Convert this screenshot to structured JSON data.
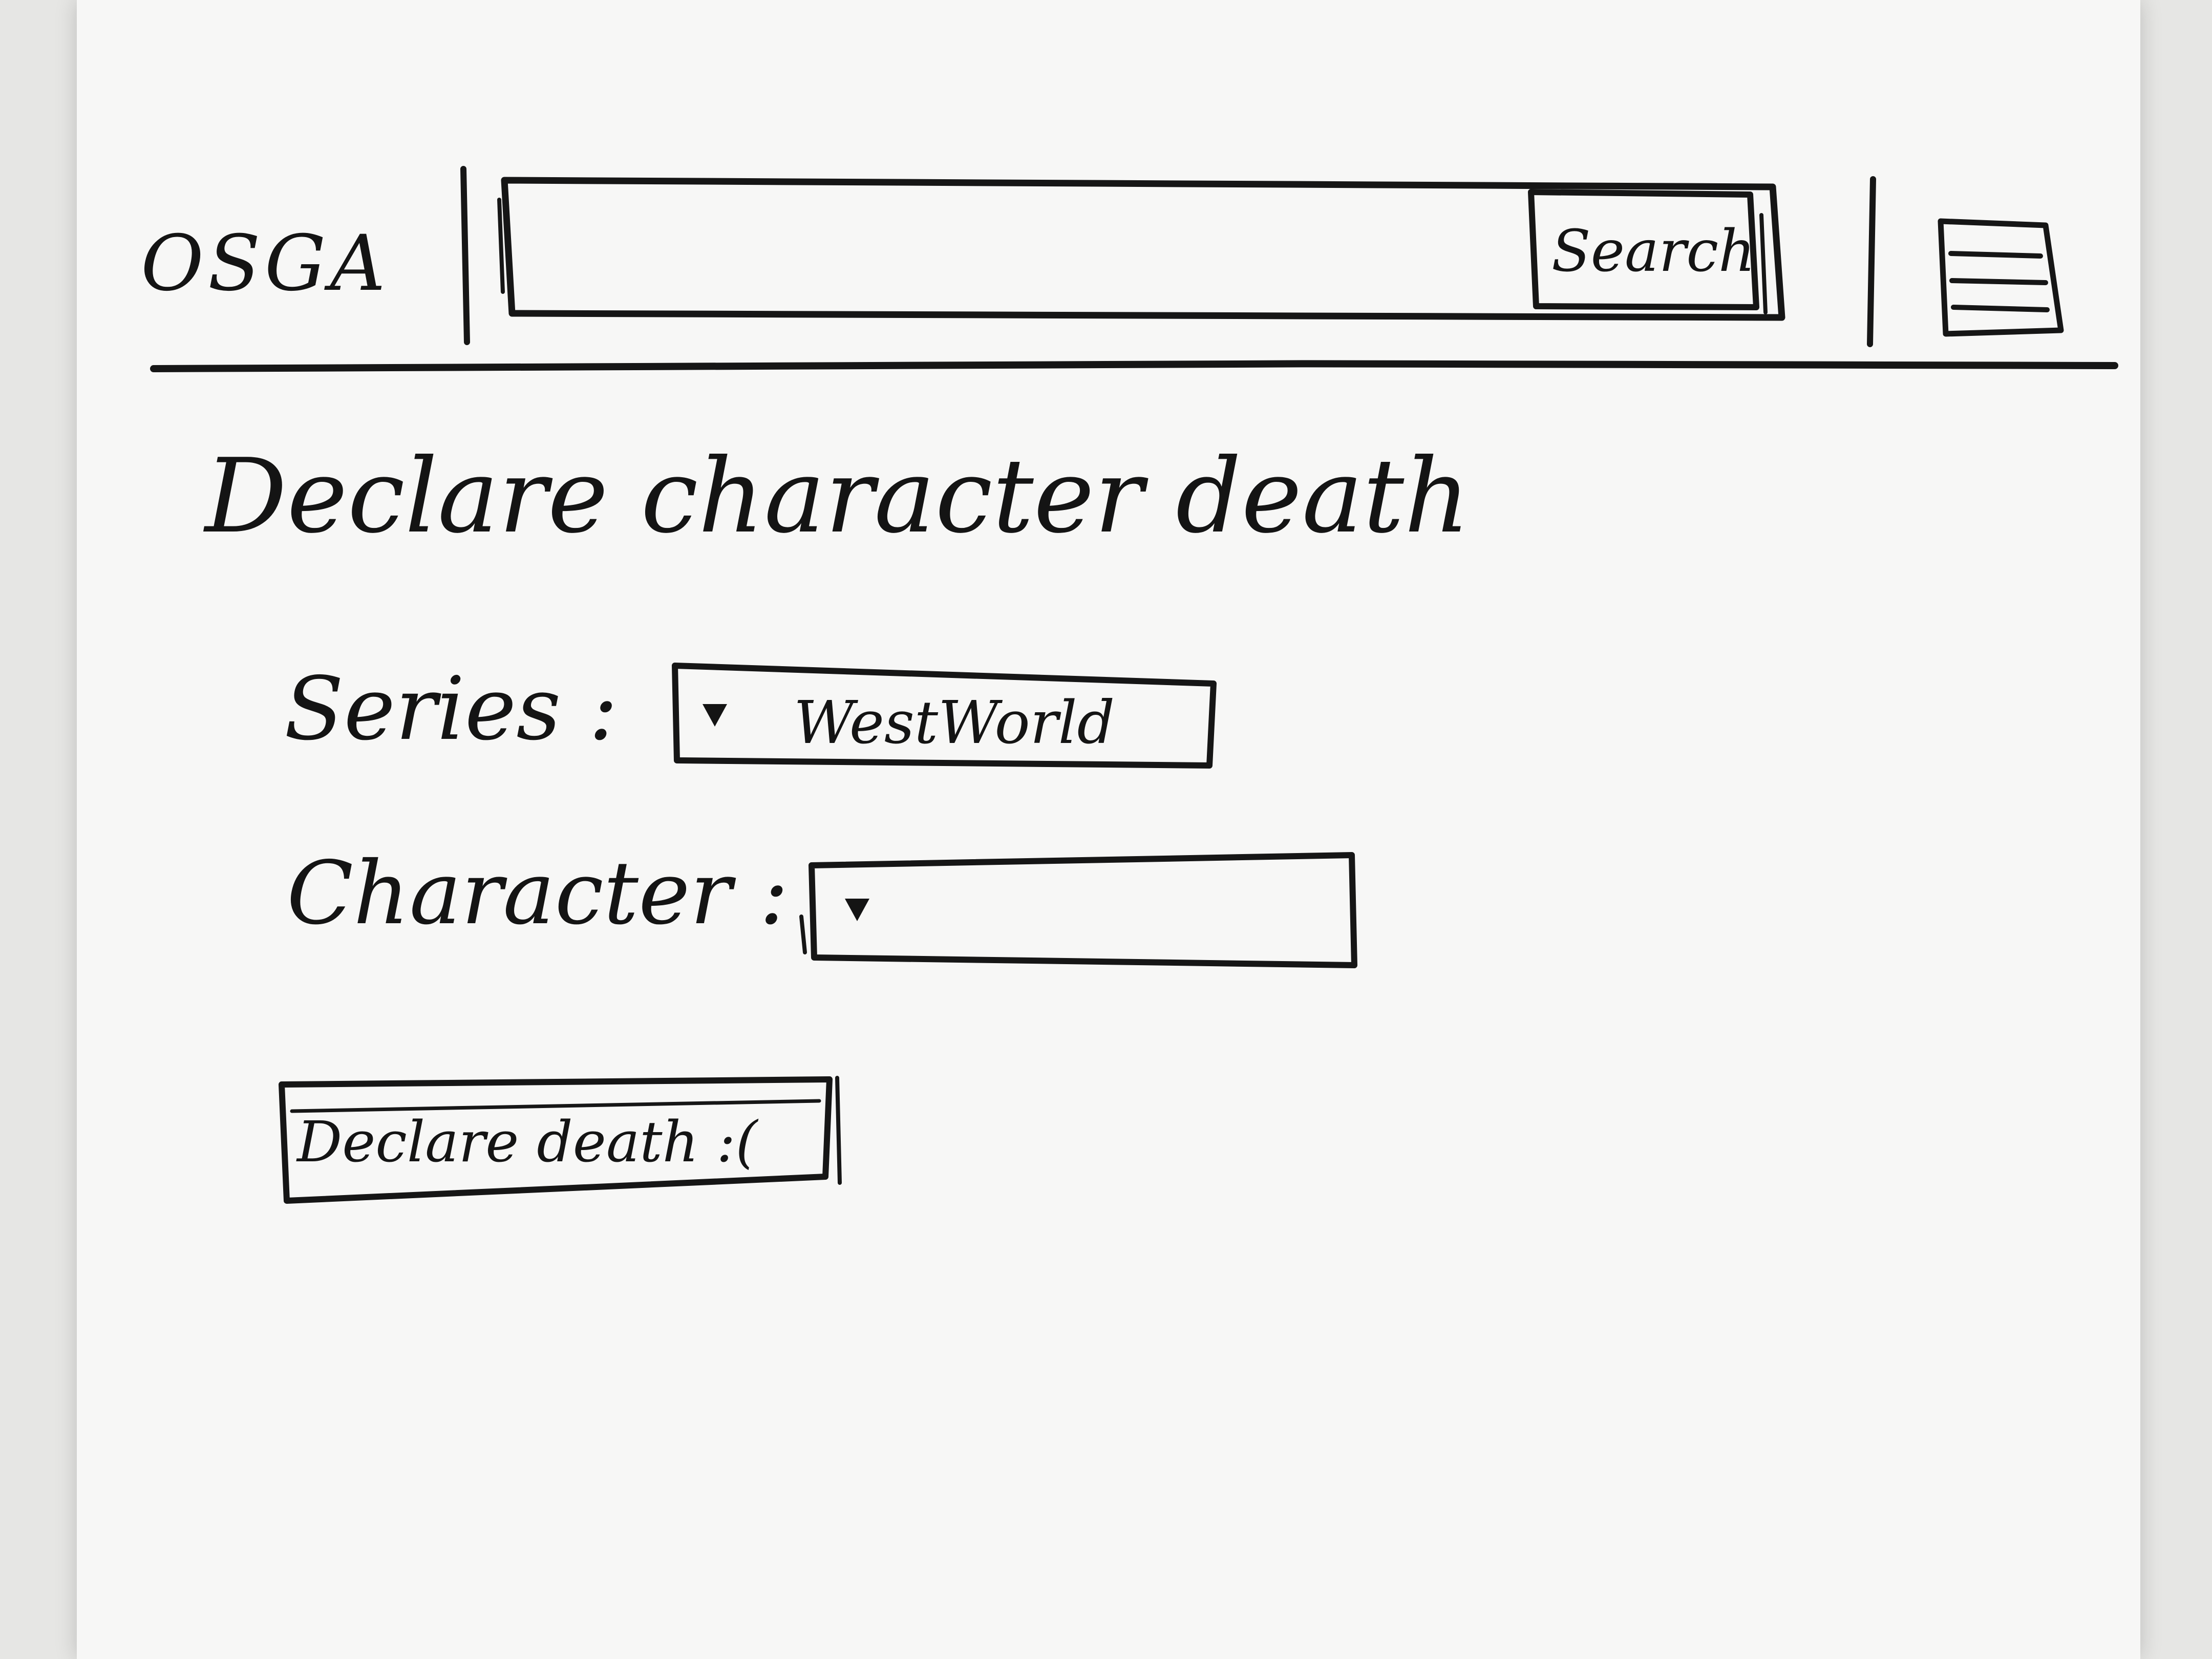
{
  "header": {
    "logo": "OSGA",
    "search": {
      "value": "",
      "button_label": "Search"
    },
    "menu_icon": "hamburger-menu-icon"
  },
  "page": {
    "title": "Declare character death"
  },
  "form": {
    "series": {
      "label": "Series :",
      "selected": "WestWorld"
    },
    "character": {
      "label": "Character :",
      "selected": ""
    },
    "submit_label": "Declare death :("
  }
}
